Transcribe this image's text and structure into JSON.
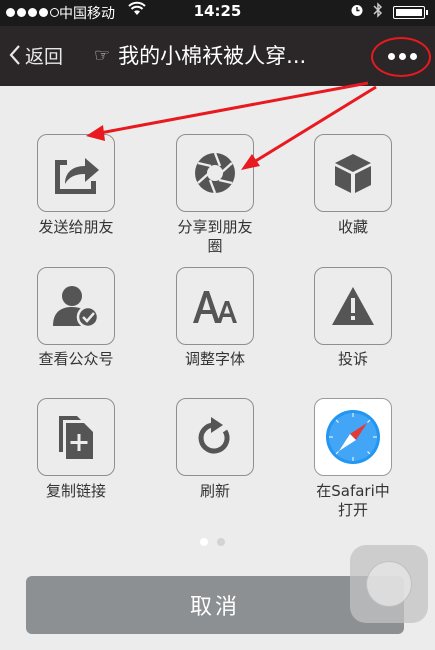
{
  "status_bar": {
    "carrier": "中国移动",
    "time": "14:25"
  },
  "nav": {
    "back_label": "返回",
    "title": "我的小棉袄被人穿..."
  },
  "share_items": [
    {
      "label": "发送给朋友",
      "icon": "send-to-friend-icon"
    },
    {
      "label": "分享到朋友\n圈",
      "icon": "moments-aperture-icon"
    },
    {
      "label": "收藏",
      "icon": "favorite-cube-icon"
    },
    {
      "label": "查看公众号",
      "icon": "official-account-icon"
    },
    {
      "label": "调整字体",
      "icon": "font-size-icon"
    },
    {
      "label": "投诉",
      "icon": "warning-icon"
    },
    {
      "label": "复制链接",
      "icon": "copy-link-icon"
    },
    {
      "label": "刷新",
      "icon": "refresh-icon"
    },
    {
      "label": "在Safari中\n打开",
      "icon": "safari-compass-icon"
    }
  ],
  "pagination": {
    "pages": 2,
    "current": 1
  },
  "cancel_label": "取消",
  "colors": {
    "nav_background": "#2b2627",
    "annotation_red": "#e8191f",
    "cancel_button": "#8c9093",
    "icon_gray": "#555555",
    "safari_blue": "#1e88e5"
  }
}
